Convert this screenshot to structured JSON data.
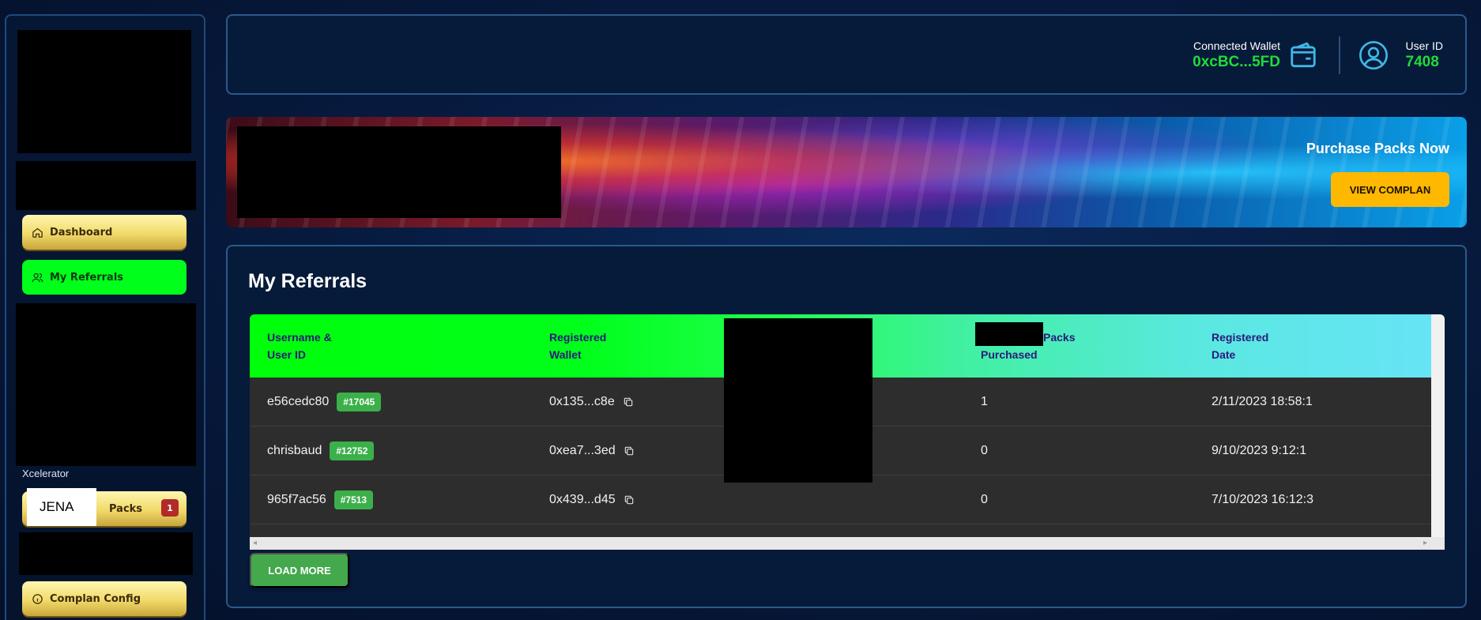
{
  "sidebar": {
    "items": [
      {
        "label": "Dashboard",
        "icon": "home-icon"
      },
      {
        "label": "My Referrals",
        "icon": "users-icon"
      },
      {
        "label": "Packs",
        "icon": "package-icon",
        "badge": "1"
      },
      {
        "label": "Complan Config",
        "icon": "info-icon"
      }
    ],
    "section_label": "Xcelerator",
    "overlay_label": "JENA"
  },
  "header": {
    "wallet_label": "Connected Wallet",
    "wallet_value": "0xcBC...5FD",
    "user_label": "User ID",
    "user_value": "7408"
  },
  "banner": {
    "title": "Purchase Packs Now",
    "button_label": "VIEW COMPLAN"
  },
  "referrals": {
    "title": "My Referrals",
    "columns": [
      "Username &\nUser ID",
      "Registered\nWallet",
      "Packs",
      "Purchased",
      "Registered\nDate"
    ],
    "rows": [
      {
        "username": "e56cedc80",
        "user_id": "#17045",
        "wallet": "0x135...c8e",
        "packs": "1",
        "date": "2/11/2023 18:58:1"
      },
      {
        "username": "chrisbaud",
        "user_id": "#12752",
        "wallet": "0xea7...3ed",
        "packs": "0",
        "date": "9/10/2023 9:12:1"
      },
      {
        "username": "965f7ac56",
        "user_id": "#7513",
        "wallet": "0x439...d45",
        "packs": "0",
        "date": "7/10/2023 16:12:3"
      }
    ],
    "load_more_label": "LOAD MORE"
  },
  "colors": {
    "accent_green": "#00ff1a",
    "wallet_green": "#1fdc3a",
    "gold": "#ffb800",
    "badge_red": "#b22a2a"
  }
}
